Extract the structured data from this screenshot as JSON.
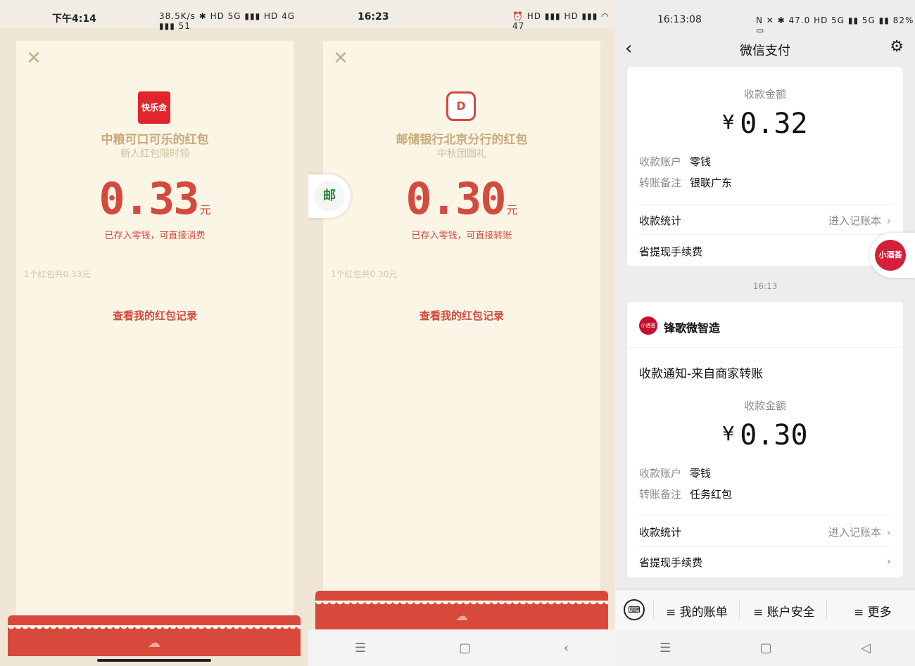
{
  "panel1": {
    "status_time": "下午4:14",
    "status_right": "38.5K/s ✱ HD 5G ▮▮▮ HD 4G ▮▮▮ 51",
    "close_icon": "✕",
    "logo_text": "快乐会",
    "title": "中粮可口可乐的红包",
    "subtitle": "新人红包限时领",
    "amount": "0.33",
    "unit": "元",
    "note": "已存入零钱，可直接消费",
    "count_text": "1个红包共0.33元",
    "record_link": "查看我的红包记录"
  },
  "panel2": {
    "status_time": "16:23",
    "status_right": "⏰ HD ▮▮▮ HD ▮▮▮ ◠ 47",
    "close_icon": "✕",
    "logo_text": "D",
    "title": "邮储银行北京分行的红包",
    "subtitle": "中秋团圆礼",
    "amount": "0.30",
    "unit": "元",
    "note": "已存入零钱，可直接转账",
    "count_text": "1个红包共0.30元",
    "record_link": "查看我的红包记录",
    "side_badge_icon": "邮",
    "nav": [
      "☰",
      "▢",
      "‹"
    ]
  },
  "panel3": {
    "status_time": "16:13:08",
    "status_right": "N ✕ ✱ 47.0 HD 5G ▮▮ 5G ▮▮ 82% ▭",
    "header_title": "微信支付",
    "back_icon": "‹",
    "gear_icon": "⚙",
    "card1": {
      "amount_label": "收款金额",
      "currency": "¥",
      "amount": "0.32",
      "account_label": "收款账户",
      "account_value": "零钱",
      "remark_label": "转账备注",
      "remark_value": "银联广东",
      "stats_label": "收款统计",
      "stats_action": "进入记账本",
      "fee_label": "省提现手续费",
      "chevron": "›"
    },
    "time_divider": "16:13",
    "card2": {
      "merchant_avatar": "小酒荟",
      "merchant_name": "锋歌微智造",
      "notice_title": "收款通知-来自商家转账",
      "amount_label": "收款金额",
      "currency": "¥",
      "amount": "0.30",
      "account_label": "收款账户",
      "account_value": "零钱",
      "remark_label": "转账备注",
      "remark_value": "任务红包",
      "stats_label": "收款统计",
      "stats_action": "进入记账本",
      "fee_label": "省提现手续费",
      "chevron": "›"
    },
    "float_badge_text": "小酒荟",
    "keyboard_icon": "⌨",
    "menu": [
      "≡ 我的账单",
      "≡ 账户安全",
      "≡ 更多"
    ],
    "nav": [
      "☰",
      "▢",
      "◁"
    ]
  },
  "colors": {
    "packet_red": "#d34a3e",
    "packet_bg": "#fbf5e6",
    "gold_text": "#c9a97a",
    "wechat_bg": "#ededed"
  }
}
